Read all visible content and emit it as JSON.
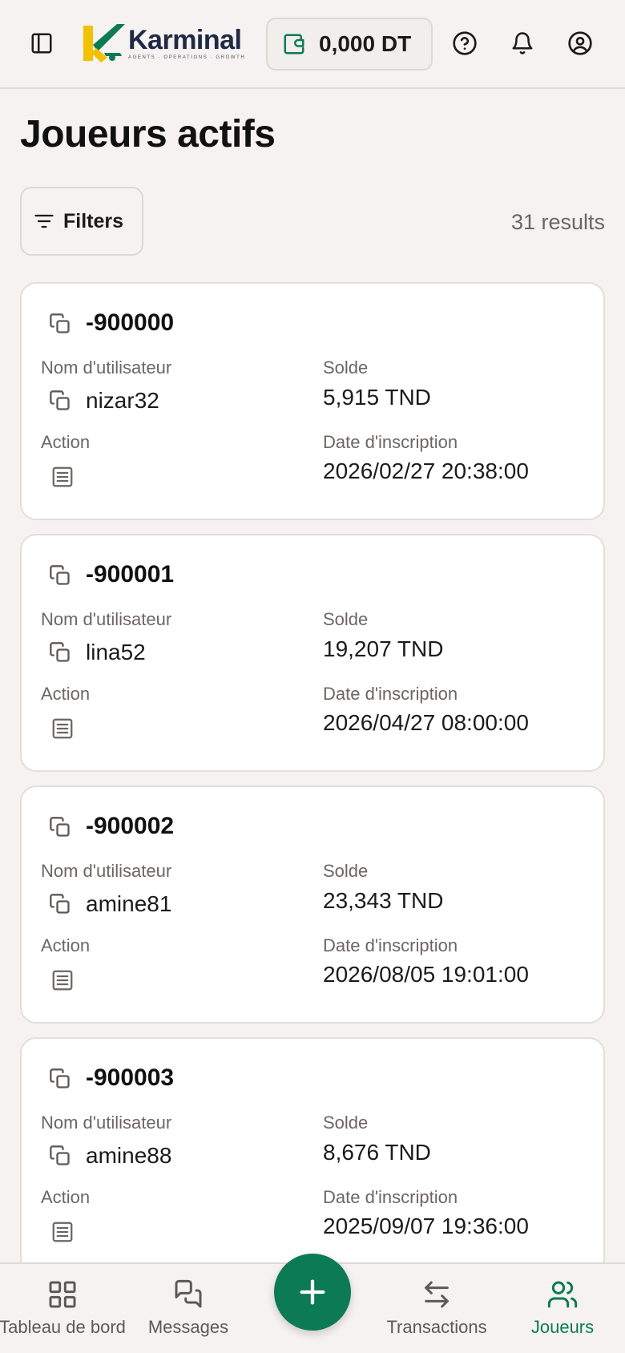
{
  "header": {
    "brand_name": "Karminal",
    "brand_tagline": "AGENTS · OPERATIONS · GROWTH",
    "balance": "0,000 DT",
    "icons": [
      "sidebar-toggle-icon",
      "wallet-icon",
      "help-icon",
      "bell-icon",
      "user-icon"
    ]
  },
  "page": {
    "title": "Joueurs actifs",
    "filters_label": "Filters",
    "results": "31 results"
  },
  "labels": {
    "username": "Nom d'utilisateur",
    "balance": "Solde",
    "action": "Action",
    "signup_date": "Date d'inscription"
  },
  "players": [
    {
      "id": "-900000",
      "username": "nizar32",
      "balance": "5,915 TND",
      "signup_date": "2026/02/27 20:38:00"
    },
    {
      "id": "-900001",
      "username": "lina52",
      "balance": "19,207 TND",
      "signup_date": "2026/04/27 08:00:00"
    },
    {
      "id": "-900002",
      "username": "amine81",
      "balance": "23,343 TND",
      "signup_date": "2026/08/05 19:01:00"
    },
    {
      "id": "-900003",
      "username": "amine88",
      "balance": "8,676 TND",
      "signup_date": "2025/09/07 19:36:00"
    }
  ],
  "nav": {
    "dashboard": "Tableau de bord",
    "messages": "Messages",
    "transactions": "Transactions",
    "players": "Joueurs",
    "active": "players"
  },
  "colors": {
    "accent": "#0b7a55",
    "background": "#f6f2f1",
    "card": "#ffffff"
  }
}
